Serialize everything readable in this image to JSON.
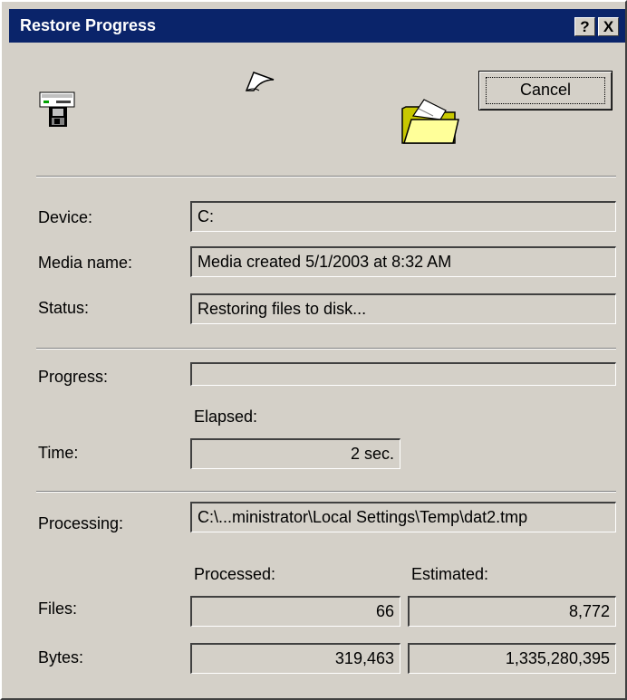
{
  "window": {
    "title": "Restore Progress",
    "help_button": "?",
    "close_button": "X"
  },
  "buttons": {
    "cancel": "Cancel"
  },
  "fields": {
    "device": {
      "label": "Device:",
      "value": "C:"
    },
    "media_name": {
      "label": "Media name:",
      "value": "Media created 5/1/2003 at 8:32 AM"
    },
    "status": {
      "label": "Status:",
      "value": "Restoring files to disk..."
    },
    "progress": {
      "label": "Progress:",
      "fraction": 0
    }
  },
  "time": {
    "label": "Time:",
    "elapsed_header": "Elapsed:",
    "elapsed_value": "2 sec."
  },
  "processing": {
    "label": "Processing:",
    "value": "C:\\...ministrator\\Local Settings\\Temp\\dat2.tmp"
  },
  "counts": {
    "processed_header": "Processed:",
    "estimated_header": "Estimated:",
    "files": {
      "label": "Files:",
      "processed": "66",
      "estimated": "8,772"
    },
    "bytes": {
      "label": "Bytes:",
      "processed": "319,463",
      "estimated": "1,335,280,395"
    }
  },
  "icons": {
    "source": "backup-drive-icon",
    "flying": "flying-paper-icon",
    "destination": "open-folder-icon"
  },
  "colors": {
    "titlebar": "#0a246a",
    "dialog_face": "#d4d0c8",
    "folder": "#ffff99"
  }
}
